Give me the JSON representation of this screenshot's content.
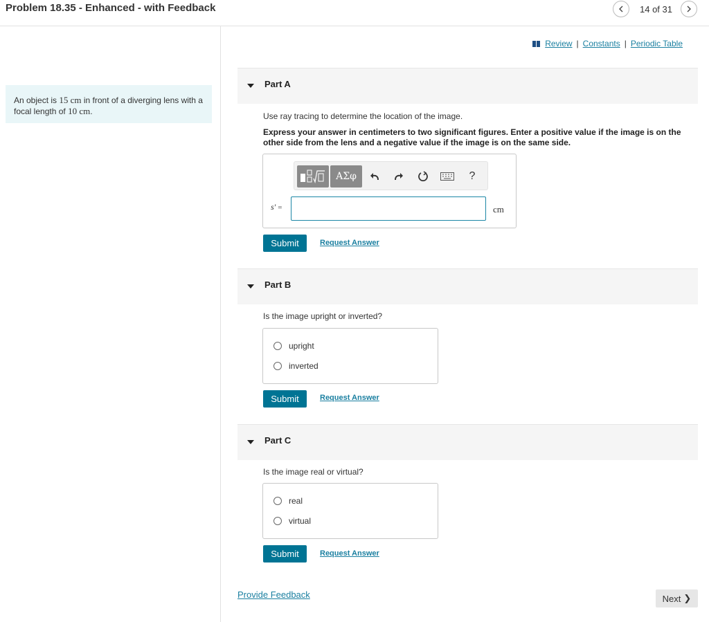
{
  "header": {
    "title": "Problem 18.35 - Enhanced - with Feedback",
    "page_count": "14 of 31"
  },
  "intro": {
    "text_before_distance": "An object is ",
    "distance": "15 cm",
    "text_middle": " in front of a diverging lens with a focal length of ",
    "focal_length": "10 cm",
    "text_end": "."
  },
  "links": {
    "review": "Review",
    "constants": "Constants",
    "periodic_table": "Periodic Table"
  },
  "part_a": {
    "title": "Part A",
    "question": "Use ray tracing to determine the location of the image.",
    "instructions": "Express your answer in centimeters to two significant figures. Enter a positive value if the image is on the other side from the lens and a negative value if the image is on the same side.",
    "variable": "s′",
    "equals": "=",
    "input_value": "",
    "unit": "cm",
    "greek_label": "ΑΣφ",
    "help_label": "?",
    "submit": "Submit",
    "request": "Request Answer"
  },
  "part_b": {
    "title": "Part B",
    "question": "Is the image upright or inverted?",
    "options": [
      "upright",
      "inverted"
    ],
    "submit": "Submit",
    "request": "Request Answer"
  },
  "part_c": {
    "title": "Part C",
    "question": "Is the image real or virtual?",
    "options": [
      "real",
      "virtual"
    ],
    "submit": "Submit",
    "request": "Request Answer"
  },
  "footer": {
    "feedback": "Provide Feedback",
    "next": "Next"
  },
  "colors": {
    "accent": "#007494",
    "link": "#1a7fa0",
    "intro_bg": "#e9f6f8",
    "part_header_bg": "#f5f5f5",
    "toolbar_button": "#8a8a8a"
  },
  "icons": [
    "chevron-left-icon",
    "chevron-right-icon",
    "book-icon",
    "template-icon",
    "undo-icon",
    "redo-icon",
    "reset-icon",
    "keyboard-icon",
    "help-icon",
    "caret-down-icon",
    "radio-icon",
    "chevron-right-small-icon"
  ]
}
